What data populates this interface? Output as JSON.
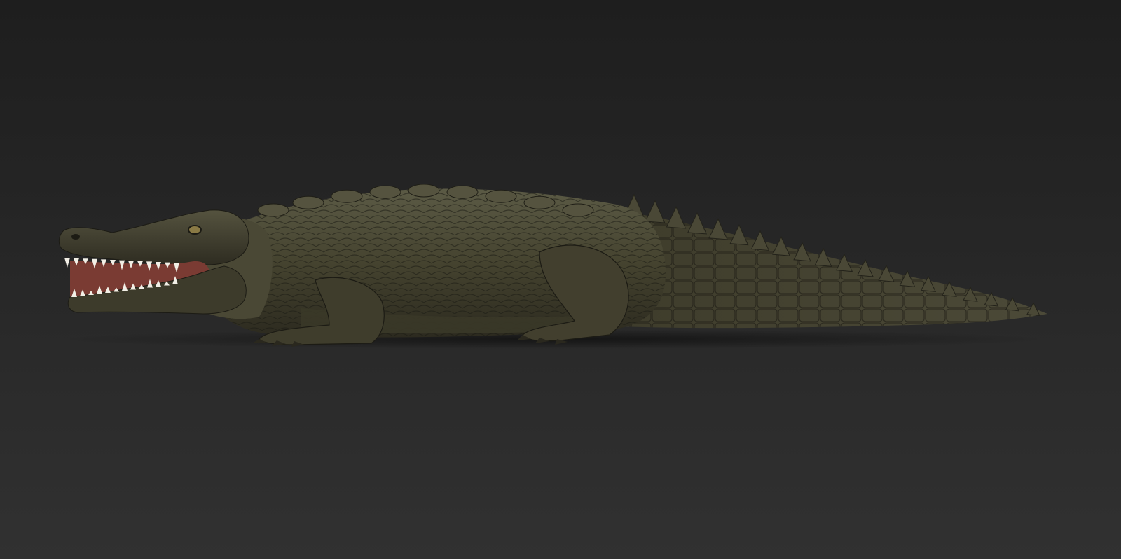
{
  "scene": {
    "subject_icon": "crocodile-icon",
    "colors": {
      "background_top": "#1e1e1e",
      "background_bottom": "#313131",
      "skin_light": "#5b5a45",
      "skin_mid": "#45432f",
      "skin_dark": "#2c2a1f",
      "skin_shadow": "#1c1b14",
      "mouth_inner": "#7a3b33",
      "teeth": "#f2efe6",
      "eye": "#8a7a45",
      "ground_shadow": "#111111"
    }
  }
}
